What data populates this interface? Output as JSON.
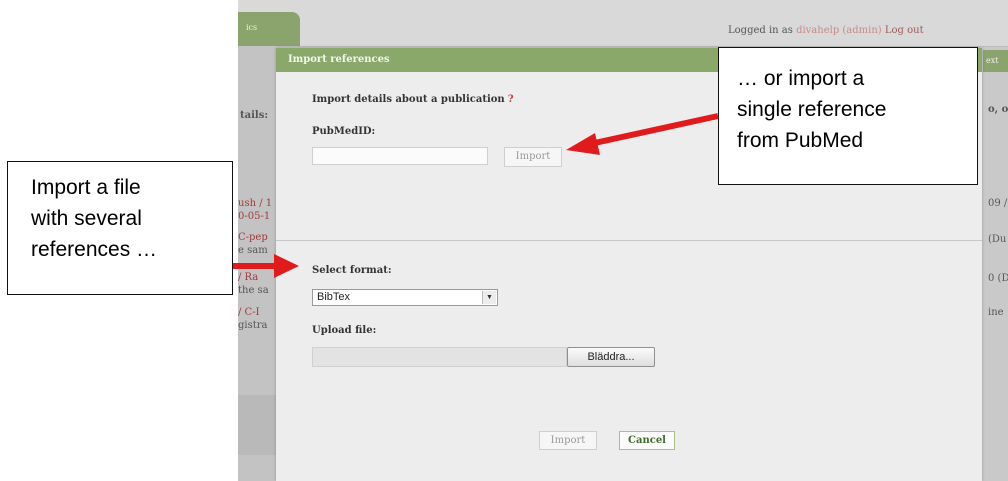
{
  "background": {
    "tab_label": "ics",
    "login_prefix": "Logged in as",
    "login_user": "divahelp (admin)",
    "logout_link": "Log out",
    "left_label": "tails:",
    "left_items": [
      "ush / 1",
      "0-05-1",
      "C-pep",
      "e sam",
      "/ Ra",
      "the sa",
      "/ C-I",
      "gistra"
    ],
    "right_tab": "ext",
    "right_items": [
      "o, o",
      "09 /",
      "(Du",
      "0 (D",
      "ine"
    ]
  },
  "dialog": {
    "title": "Import references",
    "section_heading": "Import details about a publication",
    "help_mark": "?",
    "pubmed_label": "PubMedID:",
    "pubmed_value": "",
    "pubmed_import_label": "Import",
    "format_label": "Select format:",
    "format_selected": "BibTex",
    "upload_label": "Upload file:",
    "upload_value": "",
    "browse_label": "Bläddra...",
    "import_label": "Import",
    "cancel_label": "Cancel"
  },
  "callouts": {
    "pubmed_lines": [
      "… or import a",
      "single reference",
      "from PubMed"
    ],
    "file_lines": [
      "Import a file",
      "with several",
      "references …"
    ]
  },
  "colors": {
    "header_green": "#8aa86a",
    "arrow_red": "#e01b1b",
    "help_red": "#c43c3c",
    "cancel_green": "#3d6b2a"
  }
}
